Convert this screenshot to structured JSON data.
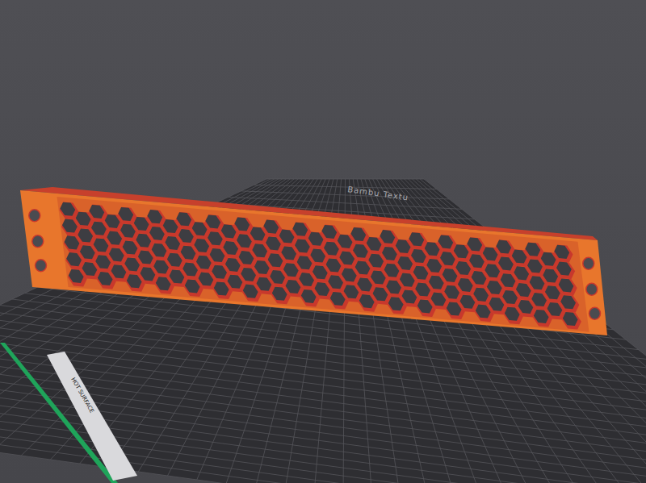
{
  "viewport": {
    "plate_label": "Bambu Textu",
    "warning_label": "HOT SURFACE"
  }
}
